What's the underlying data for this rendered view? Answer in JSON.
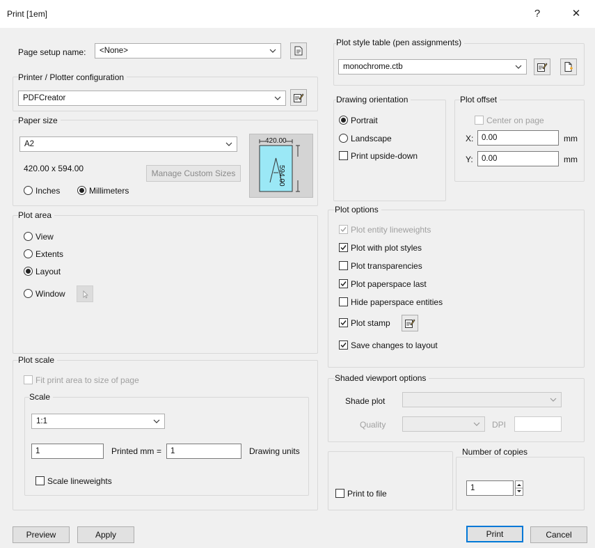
{
  "window": {
    "title": "Print [1em]",
    "help_label": "?",
    "close_label": "✕"
  },
  "page_setup": {
    "label": "Page setup name:",
    "value": "<None>"
  },
  "printer": {
    "group_title": "Printer / Plotter configuration",
    "value": "PDFCreator"
  },
  "paper": {
    "group_title": "Paper size",
    "value": "A2",
    "dimensions": "420.00 x 594.00",
    "manage_label": "Manage Custom Sizes",
    "units": [
      {
        "label": "Inches",
        "selected": false
      },
      {
        "label": "Millimeters",
        "selected": true
      }
    ],
    "preview_width_label": "420.00",
    "preview_height_label": "594.00",
    "preview_letter": "A"
  },
  "plot_area": {
    "group_title": "Plot area",
    "options": [
      {
        "label": "View",
        "selected": false
      },
      {
        "label": "Extents",
        "selected": false
      },
      {
        "label": "Layout",
        "selected": true
      },
      {
        "label": "Window",
        "selected": false
      }
    ]
  },
  "plot_scale": {
    "group_title": "Plot scale",
    "fit_label": "Fit print area to size of page",
    "scale_group_title": "Scale",
    "scale_value": "1:1",
    "printed_value": "1",
    "printed_label": "Printed mm",
    "equals": "=",
    "drawing_value": "1",
    "drawing_label": "Drawing units",
    "lineweights_label": "Scale lineweights"
  },
  "plot_style": {
    "group_title": "Plot style table (pen assignments)",
    "value": "monochrome.ctb"
  },
  "orientation": {
    "group_title": "Drawing orientation",
    "options": [
      {
        "label": "Portrait",
        "selected": true
      },
      {
        "label": "Landscape",
        "selected": false
      }
    ],
    "upside_down_label": "Print upside-down"
  },
  "plot_offset": {
    "group_title": "Plot offset",
    "center_label": "Center on page",
    "x_label": "X:",
    "x_value": "0.00",
    "y_label": "Y:",
    "y_value": "0.00",
    "unit": "mm"
  },
  "plot_options": {
    "group_title": "Plot options",
    "items": [
      {
        "label": "Plot entity lineweights",
        "checked": true,
        "disabled": true
      },
      {
        "label": "Plot with plot styles",
        "checked": true,
        "disabled": false
      },
      {
        "label": "Plot transparencies",
        "checked": false,
        "disabled": false
      },
      {
        "label": "Plot paperspace last",
        "checked": true,
        "disabled": false
      },
      {
        "label": "Hide paperspace entities",
        "checked": false,
        "disabled": false
      },
      {
        "label": "Plot stamp",
        "checked": true,
        "disabled": false
      },
      {
        "label": "Save changes to layout",
        "checked": true,
        "disabled": false
      }
    ]
  },
  "shaded": {
    "group_title": "Shaded viewport options",
    "shade_label": "Shade plot",
    "shade_value": "",
    "quality_label": "Quality",
    "quality_value": "",
    "dpi_label": "DPI",
    "dpi_value": ""
  },
  "print_to_file": {
    "label": "Print to file",
    "checked": false
  },
  "copies": {
    "group_title": "Number of copies",
    "value": "1"
  },
  "footer": {
    "preview_label": "Preview",
    "apply_label": "Apply",
    "print_label": "Print",
    "cancel_label": "Cancel"
  }
}
